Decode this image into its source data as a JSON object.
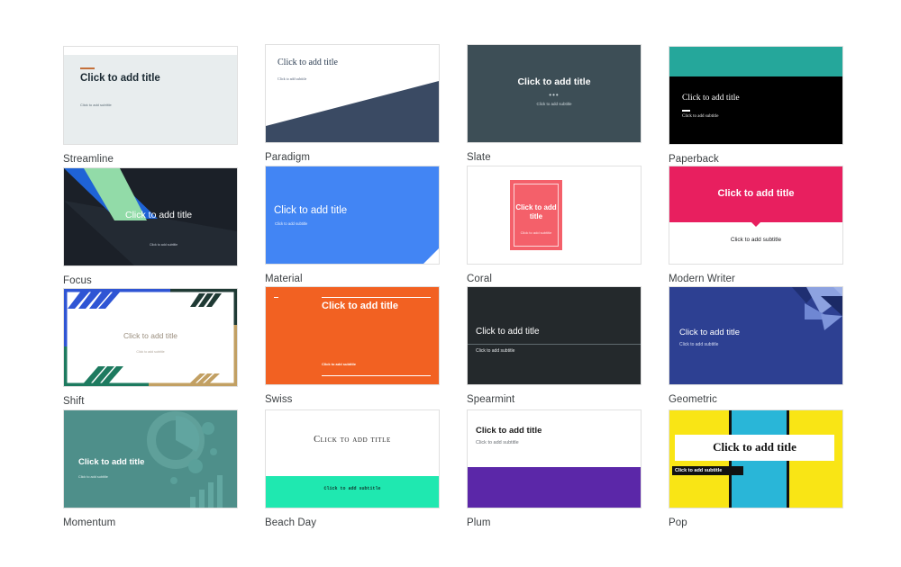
{
  "gallery": {
    "default_title_text": "Click to add title",
    "default_subtitle_text": "Click to add subtitle",
    "templates": [
      {
        "name": "Streamline",
        "title": "Click to add title",
        "subtitle": "Click to add subtitle",
        "colors": {
          "background": "#e8edee",
          "accent": "#c4703a",
          "title": "#1b2a33"
        }
      },
      {
        "name": "Paradigm",
        "title": "Click to add title",
        "subtitle": "Click to add subtitle",
        "colors": {
          "background": "#ffffff",
          "accent": "#3a4a63",
          "title": "#2e3f54"
        }
      },
      {
        "name": "Slate",
        "title": "Click to add title",
        "subtitle": "Click to add subtitle",
        "ornament": "•••",
        "colors": {
          "background": "#3d4e56",
          "accent": "#c9d3d8",
          "title": "#ffffff"
        }
      },
      {
        "name": "Paperback",
        "title": "Click to add title",
        "subtitle": "Click to add subtitle",
        "colors": {
          "background": "#000000",
          "accent": "#25a79b",
          "title": "#ffffff"
        }
      },
      {
        "name": "Focus",
        "title": "Click to add title",
        "subtitle": "Click to add subtitle",
        "colors": {
          "background": "#1b2028",
          "accent": "#1f63d6",
          "accent2": "#92dba8",
          "title": "#ffffff"
        }
      },
      {
        "name": "Material",
        "title": "Click to add title",
        "subtitle": "Click to add subtitle",
        "colors": {
          "background": "#4285f4",
          "accent": "#ffffff",
          "title": "#ffffff"
        }
      },
      {
        "name": "Coral",
        "title": "Click to add title",
        "subtitle": "Click to add subtitle",
        "colors": {
          "background": "#ffffff",
          "accent": "#f4606a",
          "title": "#ffffff"
        }
      },
      {
        "name": "Modern Writer",
        "title": "Click to add title",
        "subtitle": "Click to add subtitle",
        "colors": {
          "background": "#ffffff",
          "accent": "#e81f5f",
          "title": "#ffffff"
        }
      },
      {
        "name": "Shift",
        "title": "Click to add title",
        "subtitle": "Click to add subtitle",
        "colors": {
          "background": "#ffffff",
          "accent": "#2f55d4",
          "accent2": "#1d7a5f",
          "accent3": "#c2a063",
          "title": "#9a8e7e"
        }
      },
      {
        "name": "Swiss",
        "title": "Click to add title",
        "subtitle": "Click to add subtitle",
        "colors": {
          "background": "#f26122",
          "accent": "#ffffff",
          "title": "#ffffff"
        }
      },
      {
        "name": "Spearmint",
        "title": "Click to add title",
        "subtitle": "Click to add subtitle",
        "colors": {
          "background": "#24292c",
          "accent": "#5f6a6e",
          "title": "#ffffff"
        }
      },
      {
        "name": "Geometric",
        "title": "Click to add title",
        "subtitle": "Click to add subtitle",
        "colors": {
          "background": "#2d4092",
          "accent": "#8da2e0",
          "title": "#ffffff"
        }
      },
      {
        "name": "Momentum",
        "title": "Click to add title",
        "subtitle": "Click to add subtitle",
        "colors": {
          "background": "#4e8f8a",
          "accent": "#5fa09a",
          "title": "#ffffff"
        }
      },
      {
        "name": "Beach Day",
        "title": "Click to add title",
        "subtitle": "Click to add subtitle",
        "colors": {
          "background": "#ffffff",
          "accent": "#1fe8b0",
          "title": "#2b2b2b"
        }
      },
      {
        "name": "Plum",
        "title": "Click to add title",
        "subtitle": "Click to add subtitle",
        "colors": {
          "background": "#ffffff",
          "accent": "#5b27a8",
          "title": "#1a1a1a"
        }
      },
      {
        "name": "Pop",
        "title": "Click to add title",
        "subtitle": "Click to add subtitle",
        "colors": {
          "background": "#f9e515",
          "accent": "#29b6d8",
          "accent2": "#111111",
          "title": "#111111"
        }
      }
    ]
  }
}
